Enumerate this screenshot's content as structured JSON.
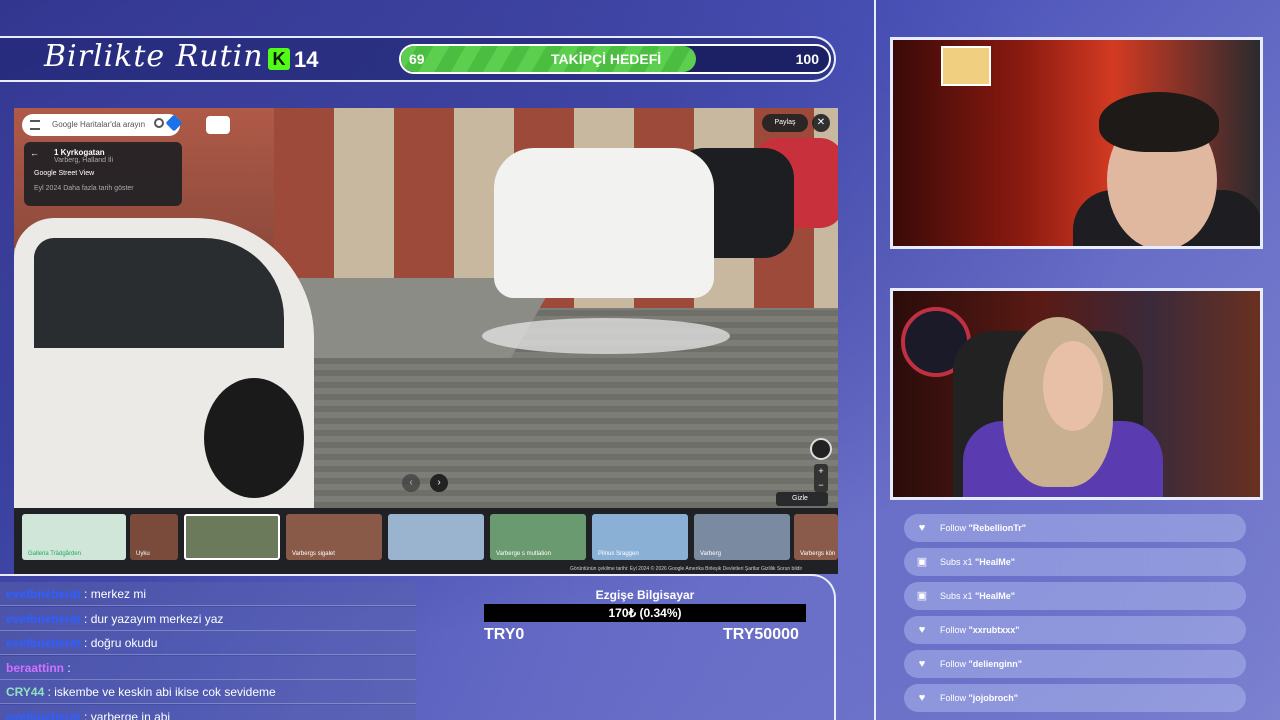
{
  "header": {
    "brand": "Birlikte Rutin",
    "kick_count": "14",
    "goal": {
      "current": "69",
      "title": "TAKİPÇİ HEDEFİ",
      "target": "100",
      "progress": 0.69
    }
  },
  "street_view": {
    "search_placeholder": "Google Haritalar'da arayın",
    "info_card": {
      "place": "1 Kyrkogatan",
      "region": "Varberg, Halland İli",
      "source": "Google Street View",
      "date": "Eyl 2024",
      "more_dates": "Daha fazla tarih göster"
    },
    "share_label": "Paylaş",
    "close_label": "✕",
    "hide_label": "Gizle",
    "thumbnails": [
      {
        "label": "Galleria Trädgården"
      },
      {
        "label": "Uyku"
      },
      {
        "label": ""
      },
      {
        "label": "Varbergs sigalet"
      },
      {
        "label": ""
      },
      {
        "label": "Varberge s mutlation"
      },
      {
        "label": "Pilnus Sraggen"
      },
      {
        "label": "Varberg"
      },
      {
        "label": "Varbergs kön"
      }
    ],
    "footer": "Görüntünün çekilme tarihi: Eyl 2024    © 2026 Google    Amerika Birleşik Devletleri    Şartlar    Gizlilik    Sorun bildir"
  },
  "chat": {
    "messages": [
      {
        "user": "evetbneberat",
        "text": "merkez mi",
        "color": "#2f5fff"
      },
      {
        "user": "evetbneberat",
        "text": "dur yazayım merkezi yaz",
        "color": "#2f5fff"
      },
      {
        "user": "evetbneberat",
        "text": "doğru okudu",
        "color": "#2f5fff"
      },
      {
        "user": "beraattinn",
        "text": "",
        "color": "#d070ff"
      },
      {
        "user": "CRY44",
        "text": "iskembe ve keskin abi ikise cok sevideme",
        "color": "#8fe0c0"
      },
      {
        "user": "evetbneberat",
        "text": "varberge in abi",
        "color": "#2f5fff"
      }
    ]
  },
  "donation": {
    "name": "Ezgişe Bilgisayar",
    "progress_text": "170₺ (0.34%)",
    "min": "TRY0",
    "max": "TRY50000"
  },
  "events": [
    {
      "type": "heart-icon",
      "kind": "Follow",
      "name": "\"RebellionTr\""
    },
    {
      "type": "gift-icon",
      "kind": "Subs x1",
      "name": "\"HealMe\""
    },
    {
      "type": "gift-icon",
      "kind": "Subs x1",
      "name": "\"HealMe\""
    },
    {
      "type": "heart-icon",
      "kind": "Follow",
      "name": "\"xxrubtxxx\""
    },
    {
      "type": "heart-icon",
      "kind": "Follow",
      "name": "\"delienginn\""
    },
    {
      "type": "heart-icon",
      "kind": "Follow",
      "name": "\"jojobroch\""
    }
  ]
}
